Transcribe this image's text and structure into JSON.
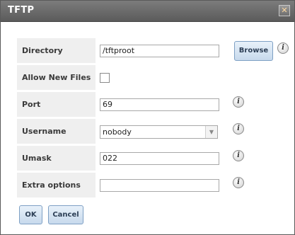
{
  "dialog": {
    "title": "TFTP",
    "close_label": "✕"
  },
  "form": {
    "directory": {
      "label": "Directory",
      "value": "/tftproot",
      "browse_label": "Browse"
    },
    "allow_new_files": {
      "label": "Allow New Files",
      "checked": false
    },
    "port": {
      "label": "Port",
      "value": "69"
    },
    "username": {
      "label": "Username",
      "value": "nobody"
    },
    "umask": {
      "label": "Umask",
      "value": "022"
    },
    "extra_options": {
      "label": "Extra options",
      "value": ""
    }
  },
  "footer": {
    "ok_label": "OK",
    "cancel_label": "Cancel"
  },
  "icons": {
    "info": "i"
  },
  "colors": {
    "titlebar": "#6b6b6b",
    "label_bg": "#efefef",
    "button_border": "#7ea0c4"
  }
}
